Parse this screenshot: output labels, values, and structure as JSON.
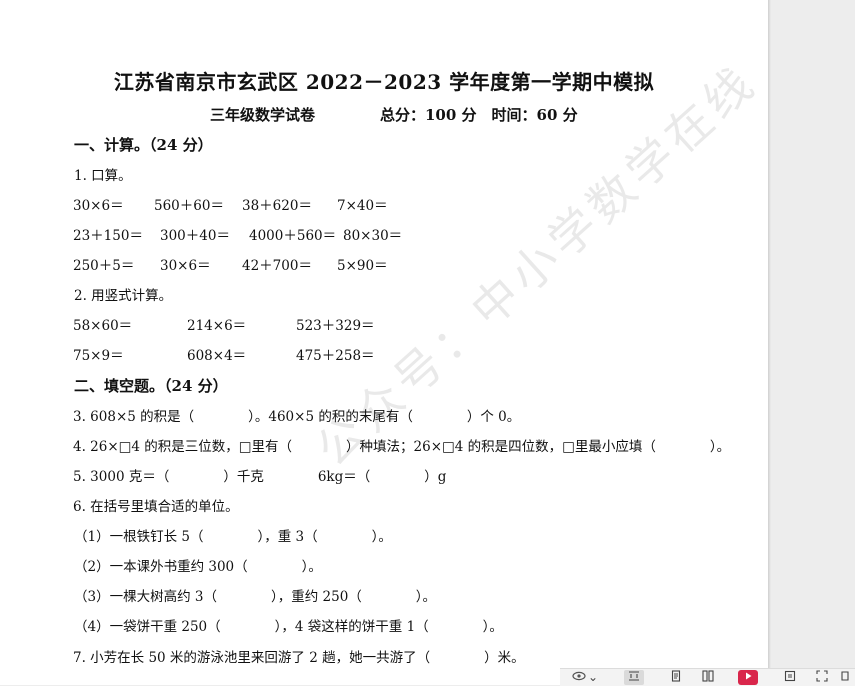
{
  "header": {
    "title": "江苏省南京市玄武区 2022－2023 学年度第一学期中模拟",
    "grade": "三年级数学试卷",
    "score_time": "总分：100 分　时间：60 分"
  },
  "section1": {
    "heading": "一、计算。（24 分）",
    "q1_label": "1. 口算。",
    "oral": [
      [
        "30×6＝",
        "560＋60＝",
        "38＋620＝",
        "7×40＝"
      ],
      [
        "23＋150＝",
        "300＋40＝",
        "4000＋560＝",
        "80×30＝"
      ],
      [
        "250＋5＝",
        "30×6＝",
        "42＋700＝",
        "5×90＝"
      ]
    ],
    "q2_label": "2. 用竖式计算。",
    "vertical": [
      [
        "58×60＝",
        "214×6＝",
        "523＋329＝"
      ],
      [
        "75×9＝",
        "608×4＝",
        "475＋258＝"
      ]
    ]
  },
  "section2": {
    "heading": "二、填空题。（24 分）",
    "q3": "3. 608×5 的积是（　　　　）。460×5 的积的末尾有（　　　　）个 0。",
    "q4": "4. 26×□4 的积是三位数，□里有（　　　　）种填法；26×□4 的积是四位数，□里最小应填（　　　　）。",
    "q5": "5. 3000 克＝（　　　　）千克　　　　6kg＝（　　　　）g",
    "q6": "6. 在括号里填合适的单位。",
    "q6_items": [
      "（1）一根铁钉长 5（　　　　），重 3（　　　　）。",
      "（2）一本课外书重约 300（　　　　）。",
      "（3）一棵大树高约 3（　　　　），重约 250（　　　　）。",
      "（4）一袋饼干重 250（　　　　），4 袋这样的饼干重 1（　　　　）。"
    ],
    "q7": "7. 小芳在长 50 米的游泳池里来回游了 2 趟，她一共游了（　　　　）米。"
  },
  "watermark": "公众号：中小学数学在线",
  "toolbar": {
    "eye_icon": "eye-icon",
    "caret": "⌄",
    "icons": [
      "fit-width-icon",
      "single-page-icon",
      "two-page-icon",
      "play-icon",
      "reader-mode-icon",
      "fullscreen-icon",
      "more-icon"
    ]
  }
}
